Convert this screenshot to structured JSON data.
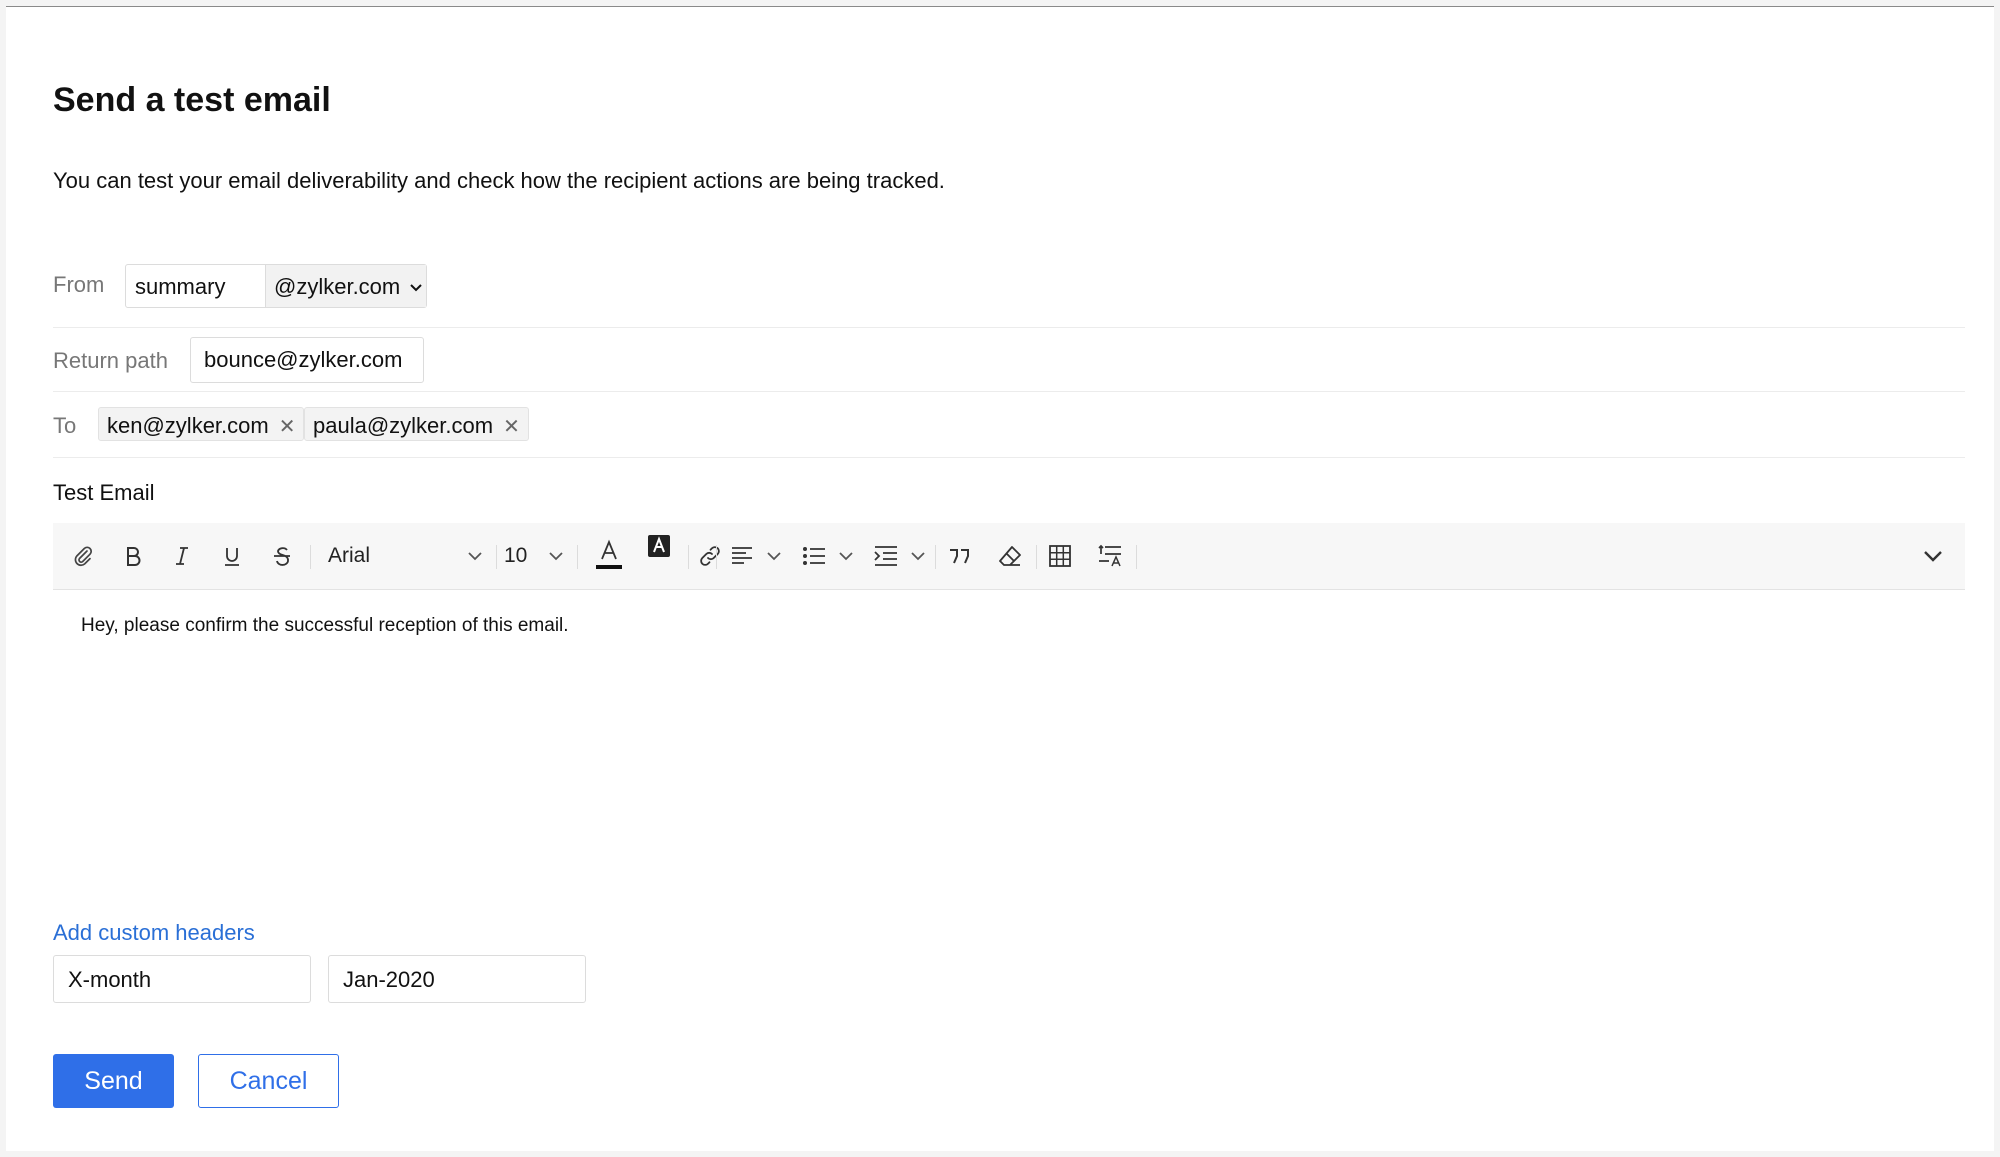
{
  "dialog": {
    "title": "Send a test email",
    "description": "You can test your email deliverability and check how the recipient actions are being tracked."
  },
  "from": {
    "label": "From",
    "local_part": "summary",
    "domain": "@zylker.com"
  },
  "return_path": {
    "label": "Return path",
    "value": "bounce@zylker.com"
  },
  "to": {
    "label": "To",
    "recipients": [
      "ken@zylker.com",
      "paula@zylker.com"
    ]
  },
  "subject": "Test Email",
  "toolbar": {
    "font_family": "Arial",
    "font_size": "10",
    "icons": [
      "attach-icon",
      "bold-icon",
      "italic-icon",
      "underline-icon",
      "strikethrough-icon",
      "text-color-icon",
      "highlight-color-icon",
      "link-icon",
      "align-icon",
      "list-icon",
      "indent-icon",
      "quote-icon",
      "clear-format-icon",
      "table-icon",
      "line-spacing-icon",
      "expand-icon"
    ]
  },
  "body_text": "Hey, please confirm the successful reception of this email.",
  "custom_headers": {
    "link_label": "Add custom headers",
    "name": "X-month",
    "value": "Jan-2020"
  },
  "actions": {
    "send_label": "Send",
    "cancel_label": "Cancel"
  },
  "colors": {
    "primary": "#2f6fe8",
    "link": "#2a6fd6"
  }
}
